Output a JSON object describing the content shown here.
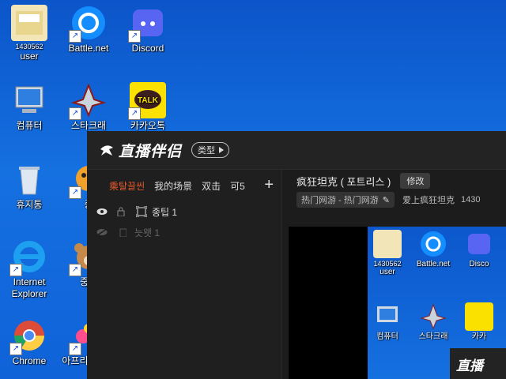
{
  "desktop": {
    "icons": [
      {
        "label": "user",
        "sub": "1430562",
        "icon": "user-folder-icon"
      },
      {
        "label": "Battle.net",
        "icon": "battlenet-icon"
      },
      {
        "label": "Discord",
        "icon": "discord-icon"
      },
      {
        "label": "컴퓨터",
        "icon": "computer-icon"
      },
      {
        "label": "스타크래",
        "icon": "starcraft-icon"
      },
      {
        "label": "카카오톡",
        "icon": "kakaotalk-icon",
        "logo_text": "TALK"
      },
      {
        "label": "휴지통",
        "icon": "recycle-bin-icon"
      },
      {
        "label": "중",
        "icon": "game-icon"
      },
      {
        "label": "Internet Explorer",
        "icon": "internet-explorer-icon"
      },
      {
        "label": "중포",
        "icon": "bear-game-icon"
      },
      {
        "label": "Chrome",
        "icon": "chrome-icon"
      },
      {
        "label": "아프리 Freec",
        "icon": "afreeca-icon"
      }
    ]
  },
  "app": {
    "logo_text": "直播伴侣",
    "type_button": "类型",
    "tabs": [
      "乘탈끌씬",
      "我的场景",
      "双击",
      "可5"
    ],
    "add_label": "+",
    "scenes": [
      {
        "name": "종팁 1",
        "visible": true
      },
      {
        "name": "늣왯 1",
        "visible": false
      }
    ],
    "stream": {
      "title": "疯狂坦克 ( 포트리스 )",
      "edit_label": "修改",
      "category": "热门网游 - 热门网游",
      "follower_text": "爱上疯狂坦克",
      "id_text": "1430"
    },
    "preview": {
      "icons": [
        {
          "label": "user",
          "sub": "1430562"
        },
        {
          "label": "Battle.net"
        },
        {
          "label": "Disco"
        },
        {
          "label": "컴퓨터"
        },
        {
          "label": "스타크래"
        },
        {
          "label": "카카"
        }
      ],
      "mini_logo": "直播"
    }
  },
  "colors": {
    "accent": "#e85a2c",
    "desktop_blue": "#0f62d8",
    "app_bg": "#1c1c1c"
  }
}
